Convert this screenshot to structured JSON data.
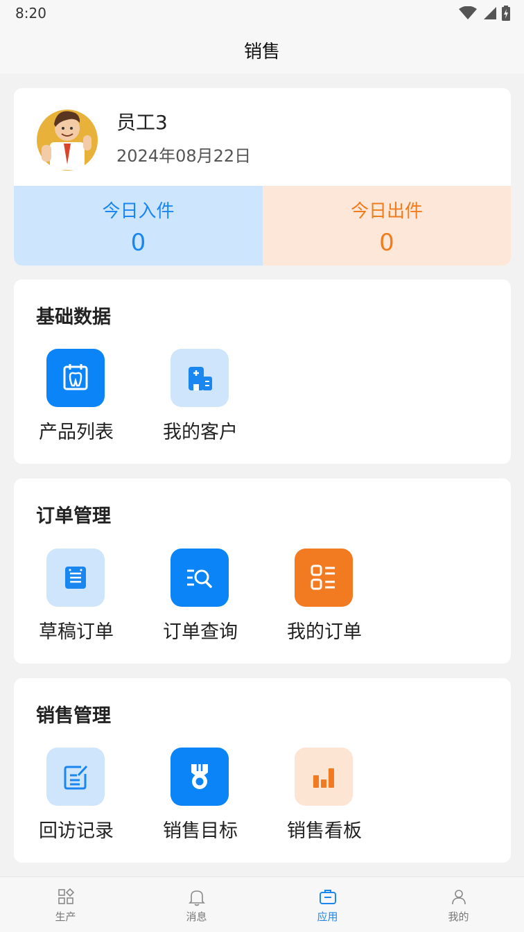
{
  "status": {
    "time": "8:20"
  },
  "header": {
    "title": "销售"
  },
  "profile": {
    "name": "员工3",
    "date": "2024年08月22日",
    "stats": [
      {
        "label": "今日入件",
        "value": "0",
        "color": "#1a86f0"
      },
      {
        "label": "今日出件",
        "value": "0",
        "color": "#f07c1e"
      }
    ]
  },
  "sections": [
    {
      "title": "基础数据",
      "items": [
        {
          "label": "产品列表",
          "icon": "tooth-calendar-icon"
        },
        {
          "label": "我的客户",
          "icon": "customer-building-icon"
        }
      ]
    },
    {
      "title": "订单管理",
      "items": [
        {
          "label": "草稿订单",
          "icon": "draft-note-icon"
        },
        {
          "label": "订单查询",
          "icon": "list-search-icon"
        },
        {
          "label": "我的订单",
          "icon": "order-list-icon"
        }
      ]
    },
    {
      "title": "销售管理",
      "items": [
        {
          "label": "回访记录",
          "icon": "edit-record-icon"
        },
        {
          "label": "销售目标",
          "icon": "medal-icon"
        },
        {
          "label": "销售看板",
          "icon": "bar-chart-icon"
        }
      ]
    }
  ],
  "tabbar": {
    "items": [
      {
        "label": "生产",
        "icon": "grid-icon"
      },
      {
        "label": "消息",
        "icon": "bell-icon"
      },
      {
        "label": "应用",
        "icon": "briefcase-icon",
        "active": true
      },
      {
        "label": "我的",
        "icon": "person-icon"
      }
    ]
  },
  "colors": {
    "accent": "#1a86f0",
    "orange": "#f27a20",
    "background": "#f2f2f2"
  }
}
